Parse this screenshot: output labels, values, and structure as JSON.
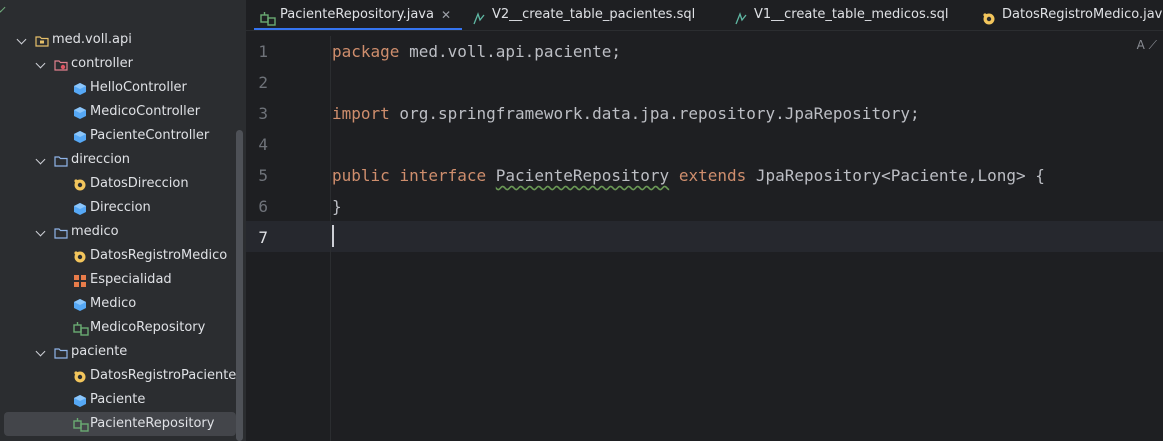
{
  "project_tree": {
    "items": [
      {
        "label": "med.voll.api",
        "icon": "package-folder-icon",
        "depth": 0,
        "expanded": true
      },
      {
        "label": "controller",
        "icon": "controller-folder-icon",
        "depth": 1,
        "expanded": true
      },
      {
        "label": "HelloController",
        "icon": "class-icon",
        "depth": 2
      },
      {
        "label": "MedicoController",
        "icon": "class-icon",
        "depth": 2
      },
      {
        "label": "PacienteController",
        "icon": "class-icon",
        "depth": 2
      },
      {
        "label": "direccion",
        "icon": "folder-icon",
        "depth": 1,
        "expanded": true
      },
      {
        "label": "DatosDireccion",
        "icon": "record-icon",
        "depth": 2
      },
      {
        "label": "Direccion",
        "icon": "class-icon",
        "depth": 2
      },
      {
        "label": "medico",
        "icon": "folder-icon",
        "depth": 1,
        "expanded": true
      },
      {
        "label": "DatosRegistroMedico",
        "icon": "record-icon",
        "depth": 2
      },
      {
        "label": "Especialidad",
        "icon": "enum-icon",
        "depth": 2
      },
      {
        "label": "Medico",
        "icon": "class-icon",
        "depth": 2
      },
      {
        "label": "MedicoRepository",
        "icon": "repository-icon",
        "depth": 2
      },
      {
        "label": "paciente",
        "icon": "folder-icon",
        "depth": 1,
        "expanded": true
      },
      {
        "label": "DatosRegistroPaciente",
        "icon": "record-icon",
        "depth": 2
      },
      {
        "label": "Paciente",
        "icon": "class-icon",
        "depth": 2
      },
      {
        "label": "PacienteRepository",
        "icon": "repository-icon",
        "depth": 2,
        "selected": true
      }
    ]
  },
  "tabs": [
    {
      "label": "PacienteRepository.java",
      "icon": "repository-icon",
      "active": true,
      "close": "✕"
    },
    {
      "label": "V2__create_table_pacientes.sql",
      "icon": "sql-file-icon"
    },
    {
      "label": "V1__create_table_medicos.sql",
      "icon": "sql-file-icon"
    },
    {
      "label": "DatosRegistroMedico.java",
      "icon": "record-icon"
    }
  ],
  "editor": {
    "current_line": 7,
    "line_numbers": [
      "1",
      "2",
      "3",
      "4",
      "5",
      "6",
      "7"
    ],
    "lines": {
      "l1": {
        "kw": "package",
        "rest": " med.voll.api.paciente;"
      },
      "l3": {
        "kw": "import",
        "rest": " org.springframework.data.jpa.repository.JpaRepository;"
      },
      "l5": {
        "kw1": "public",
        "kw2": "interface",
        "name": "PacienteRepository",
        "kw3": "extends",
        "rest": " JpaRepository<Paciente,Long> {"
      },
      "l6": {
        "text": "}"
      }
    }
  },
  "colors": {
    "keyword": "#cf8e6d",
    "text": "#bcbec4",
    "accent": "#3574f0",
    "class_icon": "#56a8f5",
    "record_icon": "#f2c55c",
    "enum_icon": "#e87c4a",
    "repository_icon": "#6aab73"
  }
}
